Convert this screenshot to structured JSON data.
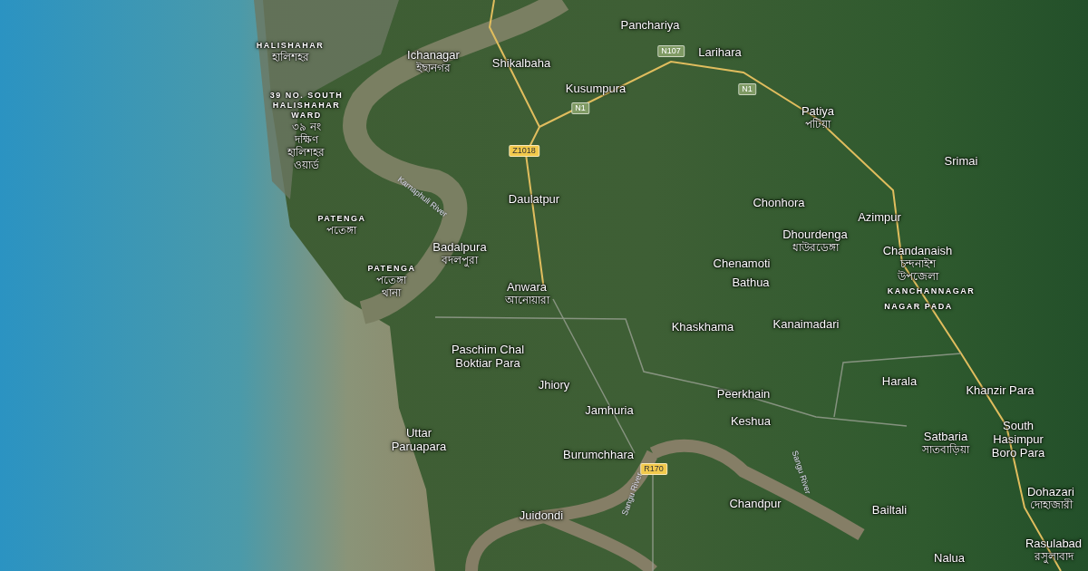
{
  "map": {
    "labels": [
      {
        "kind": "area",
        "name": "HALISHAHAR",
        "native": "হালিশহর"
      },
      {
        "kind": "area",
        "name": "39 NO. SOUTH\nHALISHAHAR\nWARD",
        "native": "৩৯ নং\nদক্ষিণ\nহালিশহর\nওয়ার্ড"
      },
      {
        "kind": "place",
        "name": "Ichanagar",
        "native": "ইছানগর"
      },
      {
        "kind": "place",
        "name": "Shikalbaha"
      },
      {
        "kind": "place",
        "name": "Panchariya"
      },
      {
        "kind": "road",
        "name": "N107",
        "color": "#7f9a64"
      },
      {
        "kind": "place",
        "name": "Larihara"
      },
      {
        "kind": "place",
        "name": "Kusumpura"
      },
      {
        "kind": "road",
        "name": "N1",
        "color": "#7f9a64"
      },
      {
        "kind": "road",
        "name": "N1",
        "color": "#7f9a64"
      },
      {
        "kind": "place",
        "name": "Patiya",
        "native": "পটিয়া"
      },
      {
        "kind": "place",
        "name": "Srimai"
      },
      {
        "kind": "road",
        "name": "Z1018",
        "color": "#f2c94c"
      },
      {
        "kind": "river",
        "name": "Karnaphuli River"
      },
      {
        "kind": "place",
        "name": "Daulatpur"
      },
      {
        "kind": "place",
        "name": "Chonhora"
      },
      {
        "kind": "area",
        "name": "PATENGA",
        "native": "পতেঙ্গা"
      },
      {
        "kind": "place",
        "name": "Azimpur"
      },
      {
        "kind": "area",
        "name": "PATENGA",
        "native": "পতেঙ্গা\nথানা"
      },
      {
        "kind": "place",
        "name": "Badalpura",
        "native": "বদলপুরা"
      },
      {
        "kind": "place",
        "name": "Anwara",
        "native": "আনোয়ারা"
      },
      {
        "kind": "place",
        "name": "Dhourdenga",
        "native": "ধাউরডেঙ্গা"
      },
      {
        "kind": "place",
        "name": "Chenamoti"
      },
      {
        "kind": "place",
        "name": "Bathua"
      },
      {
        "kind": "place",
        "name": "Chandanaish",
        "native": "চন্দনাইশ\nউপজেলা"
      },
      {
        "kind": "area",
        "name": "KANCHANNAGAR"
      },
      {
        "kind": "area",
        "name": "NAGAR PADA"
      },
      {
        "kind": "place",
        "name": "Khaskhama"
      },
      {
        "kind": "place",
        "name": "Kanaimadari"
      },
      {
        "kind": "place",
        "name": "Paschim Chal\nBoktiar Para"
      },
      {
        "kind": "place",
        "name": "Jhiory"
      },
      {
        "kind": "place",
        "name": "Peerkhain"
      },
      {
        "kind": "place",
        "name": "Harala"
      },
      {
        "kind": "place",
        "name": "Khanzir Para"
      },
      {
        "kind": "place",
        "name": "Jamhuria"
      },
      {
        "kind": "place",
        "name": "Uttar\nParuapara"
      },
      {
        "kind": "place",
        "name": "Burumchhara"
      },
      {
        "kind": "place",
        "name": "Keshua"
      },
      {
        "kind": "place",
        "name": "Satbaria",
        "native": "সাতবাড়িয়া"
      },
      {
        "kind": "place",
        "name": "South\nHasimpur\nBoro Para"
      },
      {
        "kind": "road",
        "name": "R170",
        "color": "#f2c94c"
      },
      {
        "kind": "place",
        "name": "Juidondi"
      },
      {
        "kind": "river",
        "name": "Sangu River"
      },
      {
        "kind": "place",
        "name": "Chandpur"
      },
      {
        "kind": "river",
        "name": "Sangu River"
      },
      {
        "kind": "place",
        "name": "Bailtali"
      },
      {
        "kind": "place",
        "name": "Dohazari",
        "native": "দোহাজারী"
      },
      {
        "kind": "place",
        "name": "Nalua"
      },
      {
        "kind": "place",
        "name": "Rasulabad",
        "native": "রসুলাবাদ"
      }
    ]
  }
}
